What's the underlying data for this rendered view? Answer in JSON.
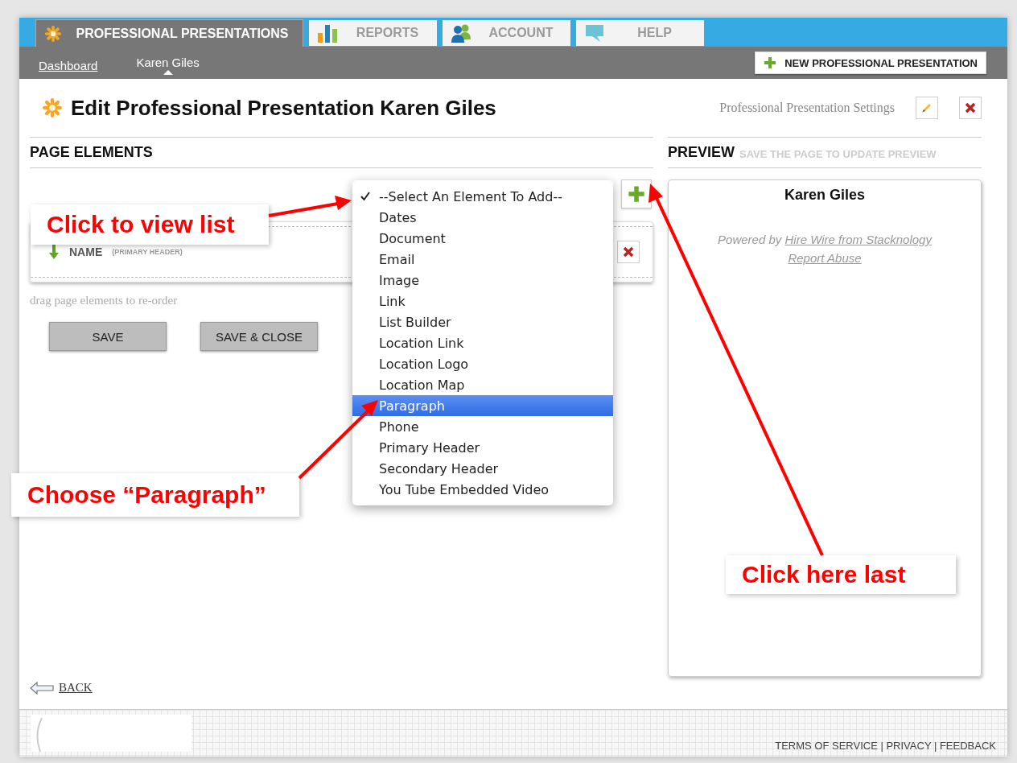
{
  "tabs": [
    {
      "label": "PROFESSIONAL PRESENTATIONS",
      "kind": "asterisk",
      "selected": true
    },
    {
      "label": "REPORTS",
      "kind": "chart",
      "selected": false
    },
    {
      "label": "ACCOUNT",
      "kind": "people",
      "selected": false
    },
    {
      "label": "HELP",
      "kind": "chat",
      "selected": false
    }
  ],
  "subnav": [
    {
      "label": "Dashboard",
      "selected": false
    },
    {
      "label": "Karen Giles",
      "selected": true
    }
  ],
  "new_button": "NEW PROFESSIONAL PRESENTATION",
  "page_title": "Edit Professional Presentation Karen Giles",
  "settings_label": "Professional Presentation Settings",
  "page_elements": {
    "heading": "PAGE ELEMENTS",
    "items": [
      {
        "name": "NAME",
        "type": "(PRIMARY HEADER)"
      }
    ],
    "hint": "drag page elements to re-order",
    "buttons": [
      "SAVE",
      "SAVE & CLOSE"
    ]
  },
  "dropdown": {
    "options": [
      {
        "label": "--Select An Element To Add--",
        "checked": true,
        "selected": false
      },
      {
        "label": "Dates",
        "checked": false,
        "selected": false
      },
      {
        "label": "Document",
        "checked": false,
        "selected": false
      },
      {
        "label": "Email",
        "checked": false,
        "selected": false
      },
      {
        "label": "Image",
        "checked": false,
        "selected": false
      },
      {
        "label": "Link",
        "checked": false,
        "selected": false
      },
      {
        "label": "List Builder",
        "checked": false,
        "selected": false
      },
      {
        "label": "Location Link",
        "checked": false,
        "selected": false
      },
      {
        "label": "Location Logo",
        "checked": false,
        "selected": false
      },
      {
        "label": "Location Map",
        "checked": false,
        "selected": false
      },
      {
        "label": "Paragraph",
        "checked": false,
        "selected": true
      },
      {
        "label": "Phone",
        "checked": false,
        "selected": false
      },
      {
        "label": "Primary Header",
        "checked": false,
        "selected": false
      },
      {
        "label": "Secondary Header",
        "checked": false,
        "selected": false
      },
      {
        "label": "You Tube Embedded Video",
        "checked": false,
        "selected": false
      }
    ]
  },
  "preview": {
    "heading": "PREVIEW",
    "note": "SAVE THE PAGE TO UPDATE PREVIEW",
    "name": "Karen Giles",
    "powered_by": "Powered by",
    "powered_link": "Hire Wire from Stacknology",
    "report_link": "Report Abuse"
  },
  "back": "BACK",
  "footer": "TERMS OF SERVICE | PRIVACY | FEEDBACK",
  "annotations": [
    "Click to view list",
    "Choose “Paragraph”",
    "Click here last"
  ]
}
